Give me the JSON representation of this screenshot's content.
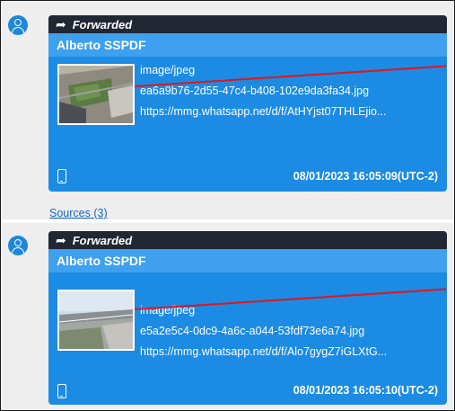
{
  "messages": [
    {
      "forwarded_label": "Forwarded",
      "sender": "Alberto SSPDF",
      "mime": "image/jpeg",
      "filename": "ea6a9b76-2d55-47c4-b408-102e9da3fa34.jpg",
      "url": "https://mmg.whatsapp.net/d/f/AtHYjst07THLEjio...",
      "timestamp": "08/01/2023 16:05:09(UTC-2)",
      "sources_label": "Sources (3)"
    },
    {
      "forwarded_label": "Forwarded",
      "sender": "Alberto SSPDF",
      "mime": "image/jpeg",
      "filename": "e5a2e5c4-0dc9-4a6c-a044-53fdf73e6a74.jpg",
      "url": "https://mmg.whatsapp.net/d/f/Alo7gygZ7iGLXtG...",
      "timestamp": "08/01/2023 16:05:10(UTC-2)"
    }
  ],
  "icons": {
    "forward": "forward-arrow-icon",
    "avatar": "user-avatar-icon",
    "device": "phone-icon"
  },
  "colors": {
    "bubble": "#1b8be3",
    "sender_bar": "#3ea0ee",
    "forward_bar": "#212733",
    "link": "#1565c0",
    "annotation_line": "#e0161c"
  }
}
